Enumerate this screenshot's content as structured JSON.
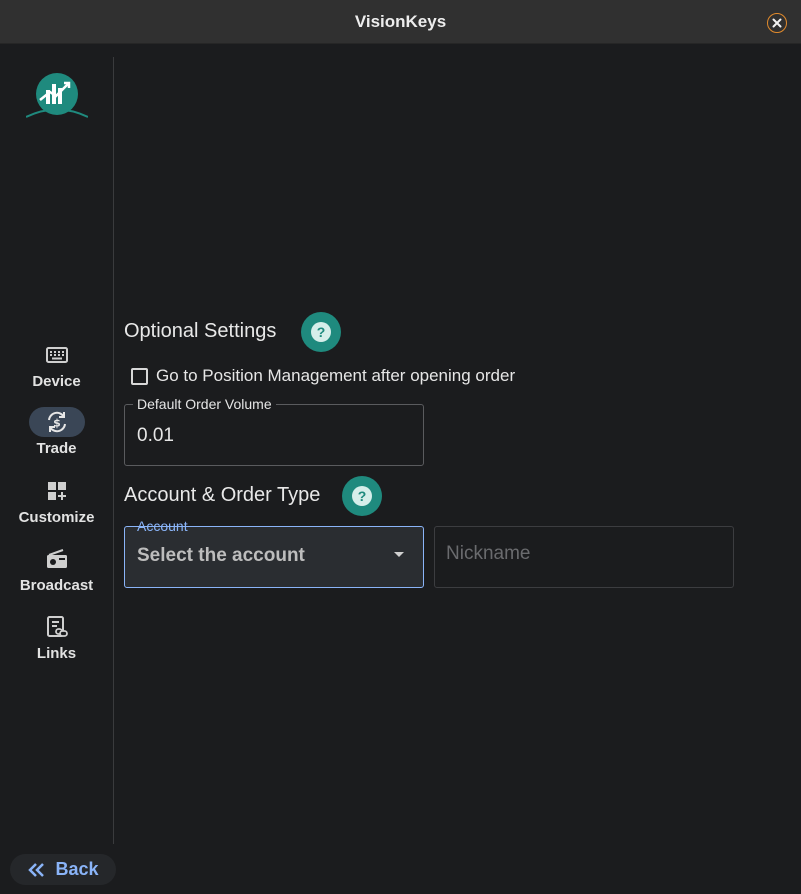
{
  "window": {
    "title": "VisionKeys",
    "close_icon": "close-icon"
  },
  "sidebar": {
    "logo": "visionkeys-logo",
    "items": [
      {
        "label": "Device",
        "icon": "keyboard-icon",
        "active": false
      },
      {
        "label": "Trade",
        "icon": "currency-exchange-icon",
        "active": true
      },
      {
        "label": "Customize",
        "icon": "dashboard-customize-icon",
        "active": false
      },
      {
        "label": "Broadcast",
        "icon": "radio-icon",
        "active": false
      },
      {
        "label": "Links",
        "icon": "link-document-icon",
        "active": false
      }
    ],
    "back_label": "Back"
  },
  "main": {
    "optional_settings": {
      "title": "Optional Settings",
      "help_icon": "help-icon",
      "checkbox_label": "Go to Position Management after opening order",
      "checkbox_checked": false,
      "volume_label": "Default Order Volume",
      "volume_value": "0.01"
    },
    "account_order": {
      "title": "Account & Order Type",
      "help_icon": "help-icon",
      "account_label": "Account",
      "account_value": "Select the account",
      "nickname_placeholder": "Nickname"
    }
  },
  "colors": {
    "accent": "#8ab4f8",
    "help_teal": "#1f8a7e",
    "close_orange": "#e08a2c",
    "background": "#1b1c1e"
  }
}
